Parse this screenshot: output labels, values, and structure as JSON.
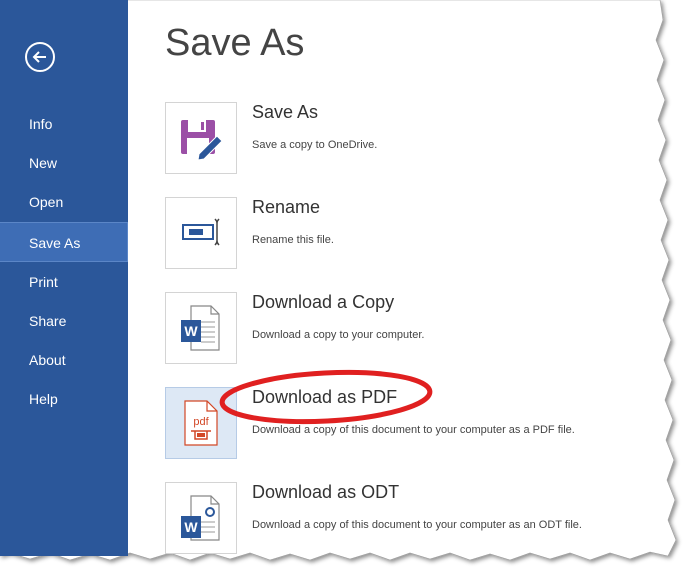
{
  "sidebar": {
    "back_icon": "back-arrow-circle-icon",
    "items": [
      {
        "label": "Info"
      },
      {
        "label": "New"
      },
      {
        "label": "Open"
      },
      {
        "label": "Save As",
        "selected": true
      },
      {
        "label": "Print"
      },
      {
        "label": "Share"
      },
      {
        "label": "About"
      },
      {
        "label": "Help"
      }
    ],
    "color": "#2b579a"
  },
  "main": {
    "title": "Save As",
    "options": [
      {
        "title": "Save As",
        "description": "Save a copy to OneDrive.",
        "icon": "floppy-disk-pencil-icon"
      },
      {
        "title": "Rename",
        "description": "Rename this file.",
        "icon": "rename-textbox-icon"
      },
      {
        "title": "Download a Copy",
        "description": "Download a copy to your computer.",
        "icon": "word-document-icon"
      },
      {
        "title": "Download as PDF",
        "description": "Download a copy of this document to your computer as a PDF file.",
        "icon": "pdf-file-icon",
        "selected": true,
        "annotation": "red-ellipse-highlight"
      },
      {
        "title": "Download as ODT",
        "description": "Download a copy of this document to your computer as an ODT file.",
        "icon": "word-odt-document-icon"
      }
    ]
  },
  "colors": {
    "accent": "#2b579a",
    "selected_nav": "#3e6db5",
    "annotation": "#e02020",
    "pdf": "#d24726",
    "word": "#2b579a"
  }
}
